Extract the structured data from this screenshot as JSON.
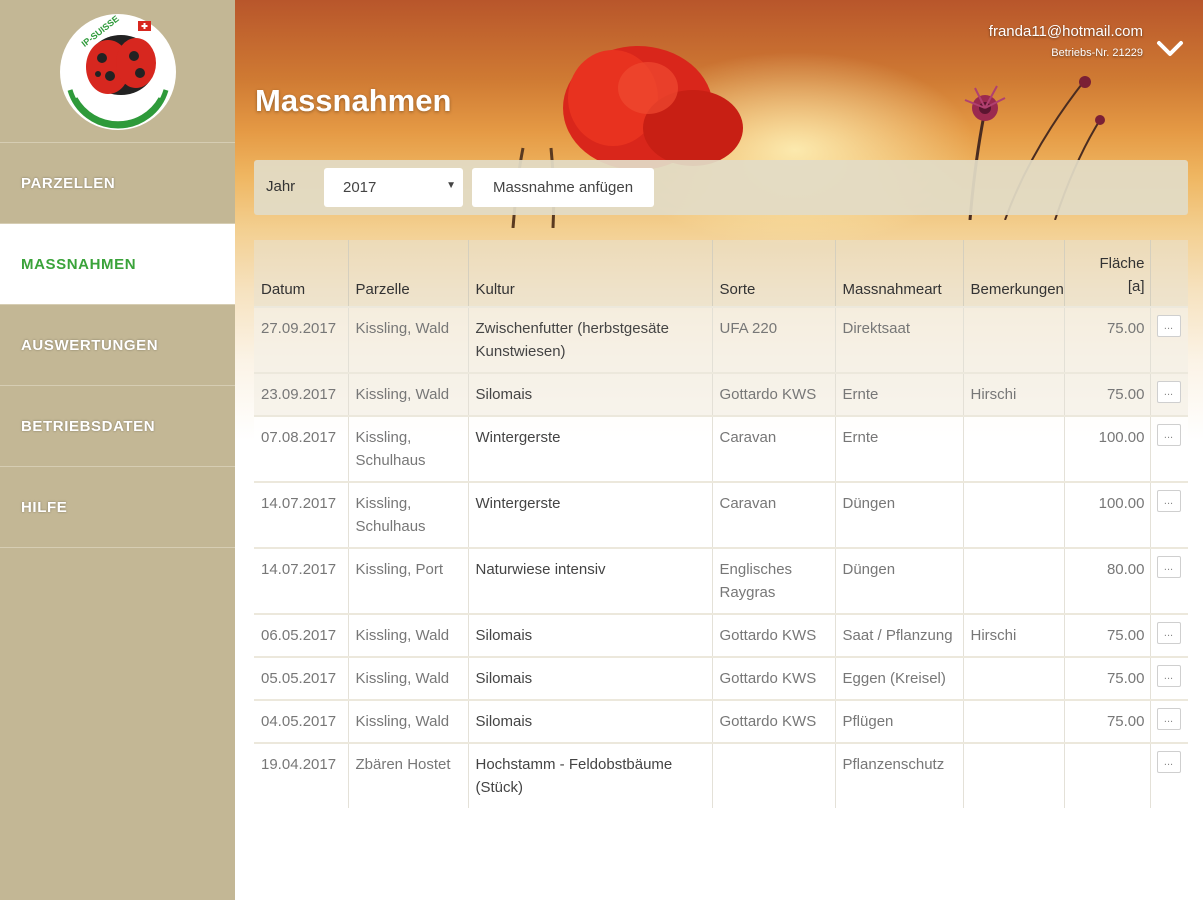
{
  "page": {
    "title": "Massnahmen"
  },
  "user": {
    "email": "franda11@hotmail.com",
    "betrieb": "Betriebs-Nr. 21229"
  },
  "logo": {
    "text": "IP-SUISSE"
  },
  "nav": {
    "items": [
      {
        "key": "parzellen",
        "label": "PARZELLEN",
        "active": false
      },
      {
        "key": "massnahmen",
        "label": "MASSNAHMEN",
        "active": true
      },
      {
        "key": "auswertungen",
        "label": "AUSWERTUNGEN",
        "active": false
      },
      {
        "key": "betriebsdaten",
        "label": "BETRIEBSDATEN",
        "active": false
      },
      {
        "key": "hilfe",
        "label": "HILFE",
        "active": false
      }
    ]
  },
  "toolbar": {
    "jahr_label": "Jahr",
    "year_value": "2017",
    "add_label": "Massnahme anfügen"
  },
  "table": {
    "columns": {
      "datum": "Datum",
      "parzelle": "Parzelle",
      "kultur": "Kultur",
      "sorte": "Sorte",
      "massnahmeart": "Massnahmeart",
      "bemerkungen": "Bemerkungen",
      "flaeche_1": "Fläche",
      "flaeche_2": "[a]"
    },
    "action_label": "...",
    "rows": [
      {
        "datum": "27.09.2017",
        "parzelle": "Kissling, Wald",
        "kultur": "Zwischenfutter (herbstgesäte Kunstwiesen)",
        "sorte": "UFA 220",
        "massnahmeart": "Direktsaat",
        "bemerkungen": "",
        "flaeche": "75.00"
      },
      {
        "datum": "23.09.2017",
        "parzelle": "Kissling, Wald",
        "kultur": "Silomais",
        "sorte": "Gottardo KWS",
        "massnahmeart": "Ernte",
        "bemerkungen": "Hirschi",
        "flaeche": "75.00"
      },
      {
        "datum": "07.08.2017",
        "parzelle": "Kissling, Schulhaus",
        "kultur": "Wintergerste",
        "sorte": "Caravan",
        "massnahmeart": "Ernte",
        "bemerkungen": "",
        "flaeche": "100.00"
      },
      {
        "datum": "14.07.2017",
        "parzelle": "Kissling, Schulhaus",
        "kultur": "Wintergerste",
        "sorte": "Caravan",
        "massnahmeart": "Düngen",
        "bemerkungen": "",
        "flaeche": "100.00"
      },
      {
        "datum": "14.07.2017",
        "parzelle": "Kissling, Port",
        "kultur": "Naturwiese intensiv",
        "sorte": "Englisches Raygras",
        "massnahmeart": "Düngen",
        "bemerkungen": "",
        "flaeche": "80.00"
      },
      {
        "datum": "06.05.2017",
        "parzelle": "Kissling, Wald",
        "kultur": "Silomais",
        "sorte": "Gottardo KWS",
        "massnahmeart": "Saat / Pflanzung",
        "bemerkungen": "Hirschi",
        "flaeche": "75.00"
      },
      {
        "datum": "05.05.2017",
        "parzelle": "Kissling, Wald",
        "kultur": "Silomais",
        "sorte": "Gottardo KWS",
        "massnahmeart": "Eggen (Kreisel)",
        "bemerkungen": "",
        "flaeche": "75.00"
      },
      {
        "datum": "04.05.2017",
        "parzelle": "Kissling, Wald",
        "kultur": "Silomais",
        "sorte": "Gottardo KWS",
        "massnahmeart": "Pflügen",
        "bemerkungen": "",
        "flaeche": "75.00"
      },
      {
        "datum": "19.04.2017",
        "parzelle": "Zbären Hostet",
        "kultur": "Hochstamm - Feldobstbäume (Stück)",
        "sorte": "",
        "massnahmeart": "Pflanzenschutz",
        "bemerkungen": "",
        "flaeche": ""
      }
    ]
  },
  "colors": {
    "sidebar": "#c3b795",
    "active_nav_text": "#3aa33a",
    "header_top": "#b8562b",
    "header_mid": "#efb661"
  },
  "icons": [
    "ladybug-logo-icon",
    "chevron-down-icon",
    "poppy-flower-icon",
    "wildflower-icon"
  ]
}
